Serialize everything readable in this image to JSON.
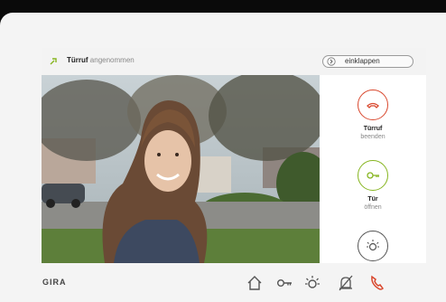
{
  "status": {
    "title": "Türruf",
    "state": "angenommen"
  },
  "collapse_label": "einklappen",
  "actions": [
    {
      "l1": "Türruf",
      "l2": "beenden",
      "icon": "hangup-icon",
      "color": "#d9482e"
    },
    {
      "l1": "Tür",
      "l2": "öffnen",
      "icon": "key-icon",
      "color": "#86b51f"
    },
    {
      "icon": "light-icon",
      "color": "#555555"
    }
  ],
  "brand": "GIRA",
  "nav_icons": [
    "home-icon",
    "key-icon",
    "light-icon",
    "mute-bell-icon",
    "phone-icon"
  ],
  "colors": {
    "accent_red": "#d9482e",
    "accent_green": "#86b51f"
  }
}
